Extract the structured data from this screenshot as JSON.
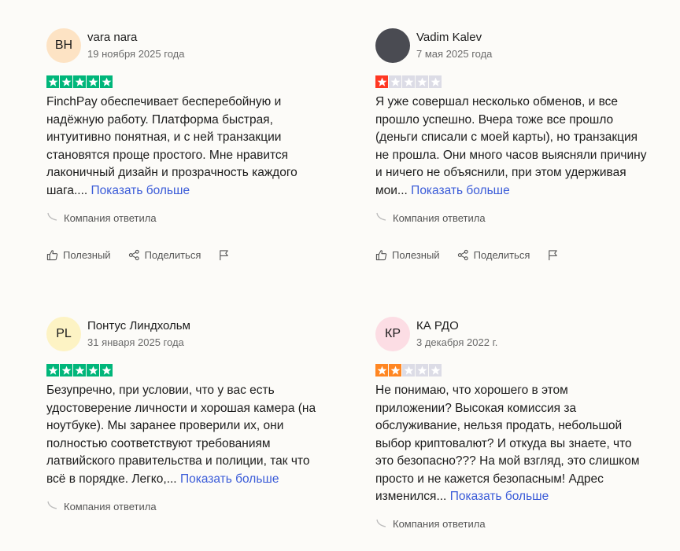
{
  "colors": {
    "star_excellent": "#00b67a",
    "star_bad": "#ff3722",
    "star_poor": "#ff8622",
    "star_empty": "#dcdce6",
    "link": "#3a5bd8"
  },
  "ui": {
    "read_more": "Показать больше",
    "company_replied": "Компания ответила",
    "helpful": "Полезный",
    "share": "Поделиться"
  },
  "reviews": [
    {
      "initials": "ВН",
      "avatar_color": "#fde3c4",
      "name": "vara nara",
      "date": "19 ноября 2025 года",
      "rating": 5,
      "text": "FinchPay обеспечивает бесперебойную и надёжную работу. Платформа быстрая, интуитивно понятная, и с ней транзакции становятся проще простого. Мне нравится лаконичный дизайн и прозрачность каждого шага....",
      "has_actions": true
    },
    {
      "initials": "",
      "avatar_color": "#4a4b52",
      "name": "Vadim Kalev",
      "date": "7 мая 2025 года",
      "rating": 1,
      "text": "Я уже совершал несколько обменов, и все прошло успешно. Вчера тоже все прошло (деньги списали с моей карты), но транзакция не прошла. Они много часов выясняли причину и ничего не объяснили, при этом удерживая мои...",
      "has_actions": true
    },
    {
      "initials": "PL",
      "avatar_color": "#fdf3c4",
      "name": "Понтус Линдхольм",
      "date": "31 января 2025 года",
      "rating": 5,
      "text": "Безупречно, при условии, что у вас есть удостоверение личности и хорошая камера (на ноутбуке). Мы заранее проверили их, они полностью соответствуют требованиям латвийского правительства и полиции, так что всё в порядке. Легко,...",
      "has_actions": false
    },
    {
      "initials": "КР",
      "avatar_color": "#fcdde4",
      "name": "КА РДО",
      "date": "3 декабря 2022 г.",
      "rating": 2,
      "text": "Не понимаю, что хорошего в этом приложении? Высокая комиссия за обслуживание, нельзя продать, небольшой выбор криптовалют? И откуда вы знаете, что это безопасно??? На мой взгляд, это слишком просто и не кажется безопасным! Адрес изменился...",
      "has_actions": false
    }
  ]
}
